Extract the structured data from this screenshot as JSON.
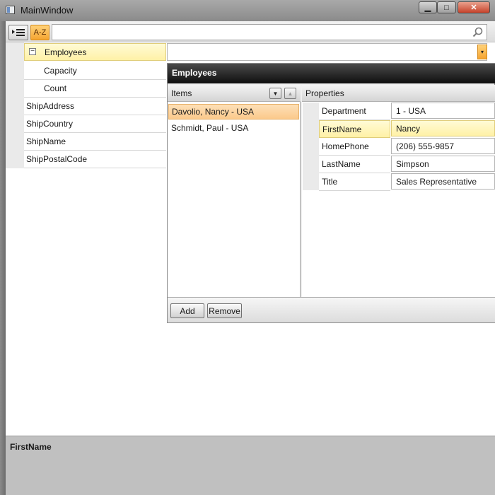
{
  "window": {
    "title": "MainWindow",
    "minimize_glyph": "▁",
    "maximize_glyph": "□",
    "close_glyph": "✕"
  },
  "toolbar": {
    "categorized_icon": "categorized-icon",
    "alphabetical_label": "A-Z",
    "search": {
      "value": "",
      "placeholder": ""
    },
    "search_icon": "search-icon"
  },
  "property_grid": {
    "expander_glyph": "−",
    "rows": [
      {
        "name": "Employees",
        "selected": true,
        "expandable": true
      },
      {
        "name": "Capacity",
        "indent": true
      },
      {
        "name": "Count",
        "indent": true
      },
      {
        "name": "ShipAddress"
      },
      {
        "name": "ShipCountry"
      },
      {
        "name": "ShipName"
      },
      {
        "name": "ShipPostalCode"
      }
    ],
    "dropdown_glyph": "▾"
  },
  "collection_editor": {
    "title": "Employees",
    "items_header": "Items",
    "properties_header": "Properties",
    "move_down_glyph": "▼",
    "move_up_glyph": "▲",
    "items": [
      {
        "label": "Davolio, Nancy - USA",
        "selected": true
      },
      {
        "label": "Schmidt, Paul - USA"
      }
    ],
    "properties": [
      {
        "name": "Department",
        "value": "1 - USA"
      },
      {
        "name": "FirstName",
        "value": "Nancy",
        "selected": true
      },
      {
        "name": "HomePhone",
        "value": "(206) 555-9857"
      },
      {
        "name": "LastName",
        "value": "Simpson"
      },
      {
        "name": "Title",
        "value": "Sales Representative"
      }
    ],
    "add_label": "Add",
    "remove_label": "Remove"
  },
  "description": {
    "title": "FirstName"
  },
  "colors": {
    "accent_orange": "#f5a430",
    "selection_yellow": "#fff1a6",
    "list_selection": "#fbc98b",
    "popup_title_bg": "#0f0f0f"
  }
}
